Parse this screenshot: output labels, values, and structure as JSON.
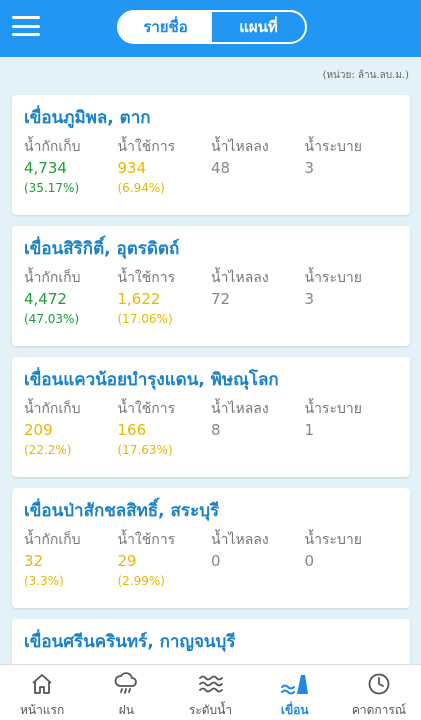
{
  "header": {
    "tabs": [
      {
        "label": "รายชื่อ",
        "active": true
      },
      {
        "label": "แผนที่",
        "active": false
      }
    ]
  },
  "unit_note": "(หน่วย: ล้าน.ลบ.ม.)",
  "stat_labels": {
    "storage": "น้ำกักเก็บ",
    "usable": "น้ำใช้การ",
    "inflow": "น้ำไหลลง",
    "outflow": "น้ำระบาย"
  },
  "dams": [
    {
      "name": "เขื่อนภูมิพล, ตาก",
      "storage": "4,734",
      "storage_pct": "(35.17%)",
      "usable": "934",
      "usable_pct": "(6.94%)",
      "inflow": "48",
      "outflow": "3"
    },
    {
      "name": "เขื่อนสิริกิติ์, อุตรดิตถ์",
      "storage": "4,472",
      "storage_pct": "(47.03%)",
      "usable": "1,622",
      "usable_pct": "(17.06%)",
      "inflow": "72",
      "outflow": "3"
    },
    {
      "name": "เขื่อนแควน้อยบำรุงแดน, พิษณุโลก",
      "storage": "209",
      "storage_pct": "(22.2%)",
      "usable": "166",
      "usable_pct": "(17.63%)",
      "inflow": "8",
      "outflow": "1"
    },
    {
      "name": "เขื่อนป่าสักชลสิทธิ์, สระบุรี",
      "storage": "32",
      "storage_pct": "(3.3%)",
      "usable": "29",
      "usable_pct": "(2.99%)",
      "inflow": "0",
      "outflow": "0"
    },
    {
      "name": "เขื่อนศรีนครินทร์, กาญจนบุรี"
    }
  ],
  "colors": {
    "primary": "#2196f3",
    "title": "#1b82c5",
    "green": "#1f9d3a",
    "yellow": "#e6b800"
  },
  "bottom_nav": [
    {
      "label": "หน้าแรก",
      "icon": "home-icon",
      "active": false
    },
    {
      "label": "ฝน",
      "icon": "rain-cloud-icon",
      "active": false
    },
    {
      "label": "ระดับน้ำ",
      "icon": "water-waves-icon",
      "active": false
    },
    {
      "label": "เขื่อน",
      "icon": "dam-icon",
      "active": true
    },
    {
      "label": "คาดการณ์",
      "icon": "clock-icon",
      "active": false
    }
  ]
}
